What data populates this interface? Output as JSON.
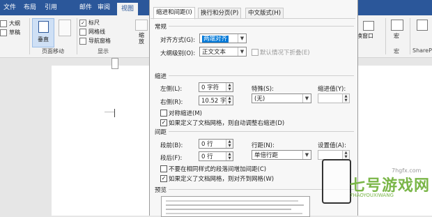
{
  "ribbon": {
    "tabs": [
      "文件",
      "布局",
      "引用",
      "邮件",
      "审阅",
      "视图"
    ],
    "active_tab": "视图",
    "left_group": {
      "item1": "大纲",
      "item2": "草稿",
      "vertical_label": "垂直",
      "group_label": "页面移动"
    },
    "show_group": {
      "ruler": "标尺",
      "gridlines": "网格线",
      "nav_pane": "导航窗格",
      "group_label": "显示",
      "zoom_partial": "缩\n放"
    },
    "right": {
      "window_label": "换窗口",
      "macro_label": "宏",
      "macro_group": "宏",
      "share_label": "ShareP"
    }
  },
  "dialog": {
    "tabs": [
      "缩进和间距(I)",
      "换行和分页(P)",
      "中文版式(H)"
    ],
    "general": {
      "section": "常规",
      "alignment_label": "对齐方式(G):",
      "alignment_value": "两端对齐",
      "outline_label": "大纲级别(O):",
      "outline_value": "正文文本",
      "collapse_label": "默认情况下折叠(E)"
    },
    "indent": {
      "section": "缩进",
      "left_label": "左侧(L):",
      "left_value": "0 字符",
      "right_label": "右侧(R):",
      "right_value": "10.52 字",
      "special_label": "特殊(S):",
      "special_value": "(无)",
      "indent_value_label": "缩进值(Y):",
      "mirror_label": "对称缩进(M)",
      "auto_adjust_label": "如果定义了文档网格，则自动调整右缩进(D)"
    },
    "spacing": {
      "section": "间距",
      "before_label": "段前(B):",
      "before_value": "0 行",
      "after_label": "段后(F):",
      "after_value": "0 行",
      "line_label": "行距(N):",
      "line_value": "单倍行距",
      "setting_label": "设置值(A):",
      "no_space_label": "不要在相同样式的段落间增加间距(C)",
      "snap_grid_label": "如果定义了文档网格，则对齐到网格(W)"
    },
    "preview": {
      "section": "预览"
    }
  },
  "watermark": {
    "brand": "七号游戏网",
    "domain": "7HAOYOUXIWANG",
    "site": "7hgfx.com"
  },
  "colors": {
    "ribbon_blue": "#2b579a",
    "selection_blue": "#0078d7",
    "watermark_green": "#7ab648"
  }
}
